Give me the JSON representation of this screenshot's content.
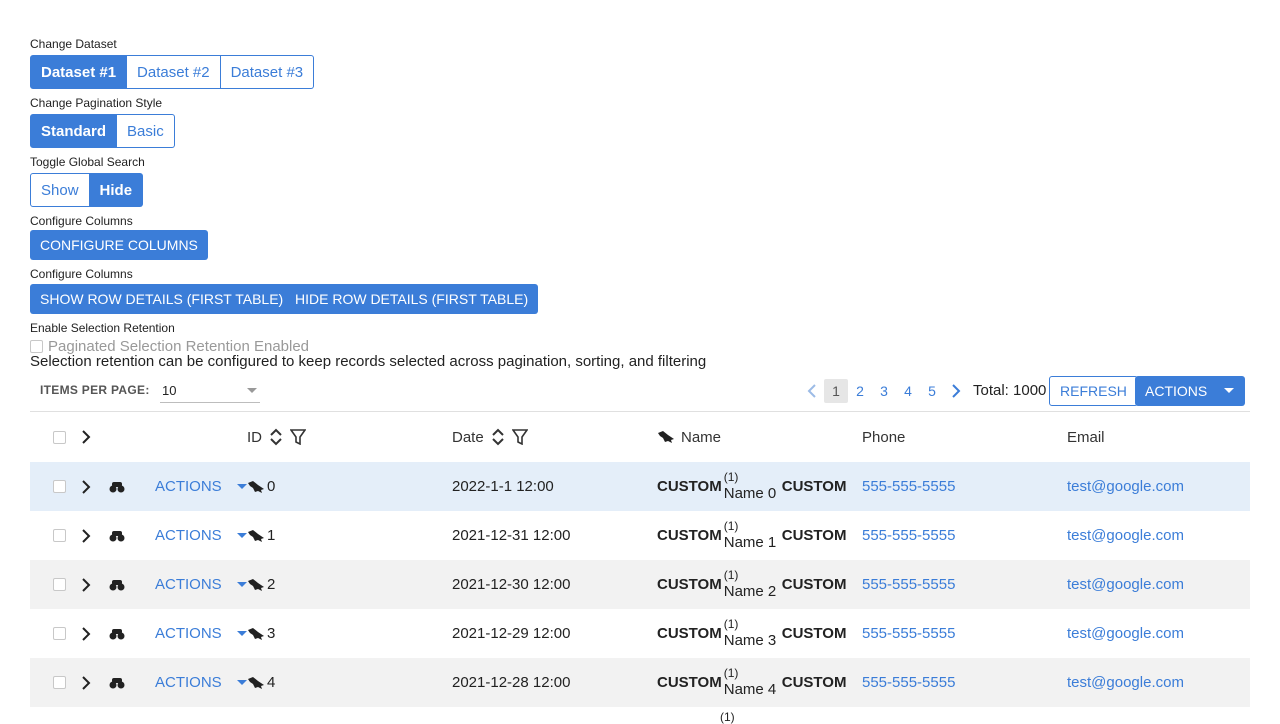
{
  "dataset": {
    "label": "Change Dataset",
    "options": [
      "Dataset #1",
      "Dataset #2",
      "Dataset #3"
    ],
    "active": "Dataset #1"
  },
  "pagination_style": {
    "label": "Change Pagination Style",
    "options": [
      "Standard",
      "Basic"
    ],
    "active": "Standard"
  },
  "global_search": {
    "label": "Toggle Global Search",
    "options": [
      "Show",
      "Hide"
    ],
    "active": "Hide"
  },
  "configure_columns": {
    "label": "Configure Columns",
    "button": "CONFIGURE COLUMNS"
  },
  "row_details": {
    "label": "Configure Columns",
    "show_button": "SHOW ROW DETAILS (FIRST TABLE)",
    "hide_button": "HIDE ROW DETAILS (FIRST TABLE)"
  },
  "selection_retention": {
    "label": "Enable Selection Retention",
    "checkbox_label": "Paginated Selection Retention Enabled",
    "description": "Selection retention can be configured to keep records selected across pagination, sorting, and filtering"
  },
  "toolbar": {
    "items_per_page_label": "ITEMS PER PAGE:",
    "items_per_page_value": "10",
    "pages": [
      "1",
      "2",
      "3",
      "4",
      "5"
    ],
    "current_page": "1",
    "total": "Total: 1000",
    "refresh": "REFRESH",
    "actions": "ACTIONS"
  },
  "columns": {
    "id": "ID",
    "date": "Date",
    "name": "Name",
    "phone": "Phone",
    "email": "Email"
  },
  "rows": [
    {
      "actions": "ACTIONS",
      "id": "0",
      "date": "2022-1-1 12:00",
      "custom_left": "CUSTOM",
      "sup": "(1)",
      "name": "Name 0",
      "custom_right": "CUSTOM",
      "phone": "555-555-5555",
      "email": "test@google.com"
    },
    {
      "actions": "ACTIONS",
      "id": "1",
      "date": "2021-12-31 12:00",
      "custom_left": "CUSTOM",
      "sup": "(1)",
      "name": "Name 1",
      "custom_right": "CUSTOM",
      "phone": "555-555-5555",
      "email": "test@google.com"
    },
    {
      "actions": "ACTIONS",
      "id": "2",
      "date": "2021-12-30 12:00",
      "custom_left": "CUSTOM",
      "sup": "(1)",
      "name": "Name 2",
      "custom_right": "CUSTOM",
      "phone": "555-555-5555",
      "email": "test@google.com"
    },
    {
      "actions": "ACTIONS",
      "id": "3",
      "date": "2021-12-29 12:00",
      "custom_left": "CUSTOM",
      "sup": "(1)",
      "name": "Name 3",
      "custom_right": "CUSTOM",
      "phone": "555-555-5555",
      "email": "test@google.com"
    },
    {
      "actions": "ACTIONS",
      "id": "4",
      "date": "2021-12-28 12:00",
      "custom_left": "CUSTOM",
      "sup": "(1)",
      "name": "Name 4",
      "custom_right": "CUSTOM",
      "phone": "555-555-5555",
      "email": "test@google.com"
    }
  ],
  "partial_row": {
    "sup": "(1)"
  },
  "colors": {
    "primary": "#3b7dd8",
    "selected_row": "#e4eef9",
    "alt_row": "#f2f2f2"
  }
}
